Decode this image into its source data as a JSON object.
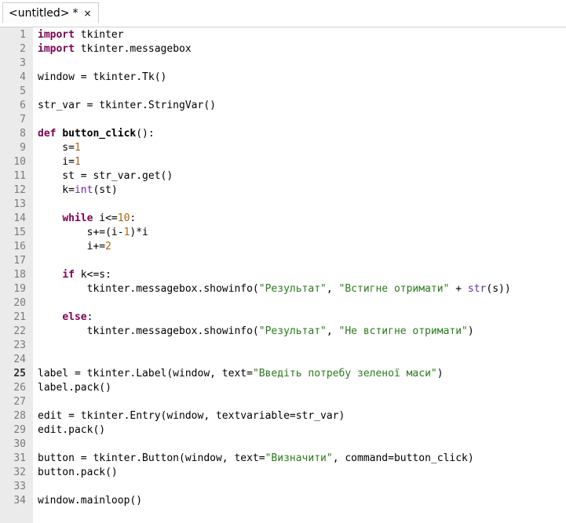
{
  "tab": {
    "title": "<untitled>",
    "modified_mark": "*",
    "close_glyph": "×"
  },
  "editor": {
    "current_line": 25,
    "lines": [
      [
        [
          "kw",
          "import"
        ],
        [
          "t",
          " tkinter"
        ]
      ],
      [
        [
          "kw",
          "import"
        ],
        [
          "t",
          " tkinter.messagebox"
        ]
      ],
      [],
      [
        [
          "t",
          "window = tkinter.Tk()"
        ]
      ],
      [],
      [
        [
          "t",
          "str_var = tkinter.StringVar()"
        ]
      ],
      [],
      [
        [
          "kw",
          "def"
        ],
        [
          "t",
          " "
        ],
        [
          "fn",
          "button_click"
        ],
        [
          "t",
          "():"
        ]
      ],
      [
        [
          "t",
          "    s="
        ],
        [
          "num",
          "1"
        ]
      ],
      [
        [
          "t",
          "    i="
        ],
        [
          "num",
          "1"
        ]
      ],
      [
        [
          "t",
          "    st = str_var.get()"
        ]
      ],
      [
        [
          "t",
          "    k="
        ],
        [
          "bi",
          "int"
        ],
        [
          "t",
          "(st)"
        ]
      ],
      [],
      [
        [
          "t",
          "    "
        ],
        [
          "kw",
          "while"
        ],
        [
          "t",
          " i<="
        ],
        [
          "num",
          "10"
        ],
        [
          "t",
          ":"
        ]
      ],
      [
        [
          "t",
          "        s+=(i-"
        ],
        [
          "num",
          "1"
        ],
        [
          "t",
          ")*i"
        ]
      ],
      [
        [
          "t",
          "        i+="
        ],
        [
          "num",
          "2"
        ]
      ],
      [],
      [
        [
          "t",
          "    "
        ],
        [
          "kw",
          "if"
        ],
        [
          "t",
          " k<=s:"
        ]
      ],
      [
        [
          "t",
          "        tkinter.messagebox.showinfo("
        ],
        [
          "str",
          "\"Результат\""
        ],
        [
          "t",
          ", "
        ],
        [
          "str",
          "\"Встигне отримати\""
        ],
        [
          "t",
          " + "
        ],
        [
          "bi",
          "str"
        ],
        [
          "t",
          "(s))"
        ]
      ],
      [],
      [
        [
          "t",
          "    "
        ],
        [
          "kw",
          "else"
        ],
        [
          "t",
          ":"
        ]
      ],
      [
        [
          "t",
          "        tkinter.messagebox.showinfo("
        ],
        [
          "str",
          "\"Результат\""
        ],
        [
          "t",
          ", "
        ],
        [
          "str",
          "\"Не встигне отримати\""
        ],
        [
          "t",
          ")"
        ]
      ],
      [],
      [],
      [
        [
          "t",
          "label = tkinter.Label(window, text="
        ],
        [
          "str",
          "\"Введіть потребу зеленої маси\""
        ],
        [
          "t",
          ")"
        ]
      ],
      [
        [
          "t",
          "label.pack()"
        ]
      ],
      [],
      [
        [
          "t",
          "edit = tkinter.Entry(window, textvariable=str_var)"
        ]
      ],
      [
        [
          "t",
          "edit.pack()"
        ]
      ],
      [],
      [
        [
          "t",
          "button = tkinter.Button(window, text="
        ],
        [
          "str",
          "\"Визначити\""
        ],
        [
          "t",
          ", command=button_click)"
        ]
      ],
      [
        [
          "t",
          "button.pack()"
        ]
      ],
      [],
      [
        [
          "t",
          "window.mainloop()"
        ]
      ]
    ]
  },
  "colors": {
    "keyword": "#7f0055",
    "number": "#b5600a",
    "string": "#2a7a1a",
    "builtin": "#6a2aa8",
    "gutter": "#ebebeb"
  }
}
